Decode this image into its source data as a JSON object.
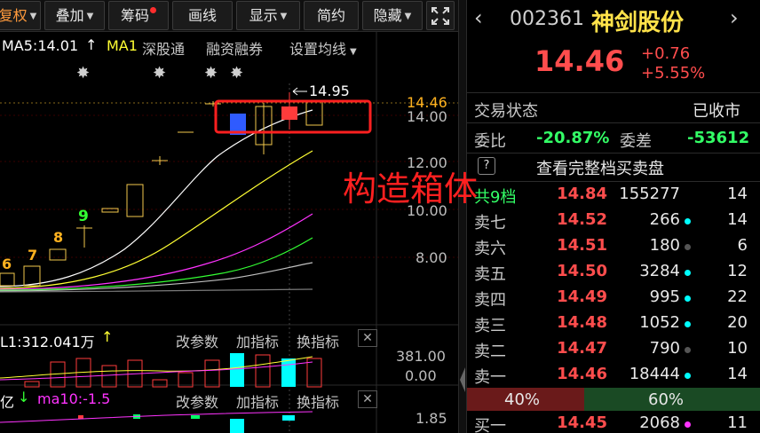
{
  "toolbar": {
    "fuquan": "复权",
    "diejia": "叠加",
    "chouma": "筹码",
    "huaxian": "画线",
    "xianshi": "显示",
    "jianyue": "简约",
    "yincang": "隐藏"
  },
  "chart": {
    "ma_legend": {
      "ma5": "MA5:14.01",
      "ma1": "MA1",
      "shentong": "深股通",
      "rongzi": "融资融券",
      "set_ma": "设置均线"
    },
    "price_axis": [
      "14.00",
      "12.00",
      "10.00",
      "8.00"
    ],
    "current_price_tag": "14.46",
    "high_marker": "14.95",
    "day_counts": [
      "6",
      "7",
      "8",
      "9"
    ],
    "annotation": "构造箱体",
    "volume_panel": {
      "legend": "L1:312.041万",
      "gai_canshu": "改参数",
      "jia_zhibiao": "加指标",
      "huan_zhibiao": "换指标",
      "axis": [
        "381.00",
        "0.00"
      ]
    },
    "third_panel": {
      "legend_a": "亿",
      "legend_b": "ma10:-1.5",
      "gai_canshu": "改参数",
      "jia_zhibiao": "加指标",
      "huan_zhibiao": "换指标",
      "axis": [
        "1.85"
      ]
    },
    "colors": {
      "up": "#ff3b3b",
      "down": "#2f5bff",
      "candle_outline": "#f2c94c",
      "annotation": "#ff2020",
      "ma5": "#ffffff",
      "ma10": "#ffff33",
      "ma20": "#ff33ff",
      "ma30": "#33ff33",
      "volume_cyan": "#00ffff"
    }
  },
  "quote": {
    "code": "002361",
    "name": "神剑股份",
    "price": "14.46",
    "change": "+0.76",
    "change_pct": "+5.55%",
    "trade_status_label": "交易状态",
    "trade_status_value": "已收市",
    "weibi_label": "委比",
    "weibi_value": "-20.87%",
    "weicha_label": "委差",
    "weicha_value": "-53612",
    "view_full": "查看完整档买卖盘",
    "total_label": "共9档",
    "total_price": "14.84",
    "total_vol": "155277",
    "total_cnt": "14",
    "asks": [
      {
        "label": "卖七",
        "price": "14.52",
        "vol": "266",
        "dot": "#00ffff",
        "cnt": "14"
      },
      {
        "label": "卖六",
        "price": "14.51",
        "vol": "180",
        "dot": "#555555",
        "cnt": "6"
      },
      {
        "label": "卖五",
        "price": "14.50",
        "vol": "3284",
        "dot": "#00ffff",
        "cnt": "12"
      },
      {
        "label": "卖四",
        "price": "14.49",
        "vol": "995",
        "dot": "#00ffff",
        "cnt": "22"
      },
      {
        "label": "卖三",
        "price": "14.48",
        "vol": "1052",
        "dot": "#00ffff",
        "cnt": "20"
      },
      {
        "label": "卖二",
        "price": "14.47",
        "vol": "790",
        "dot": "#555555",
        "cnt": "10"
      },
      {
        "label": "卖一",
        "price": "14.46",
        "vol": "18444",
        "dot": "#00ffff",
        "cnt": "14"
      }
    ],
    "ratio_sell": "40%",
    "ratio_buy": "60%",
    "sell_ratio_value": 0.4,
    "bids": [
      {
        "label": "买一",
        "price": "14.45",
        "vol": "2068",
        "dot": "#ff33ff",
        "cnt": "11"
      }
    ]
  }
}
